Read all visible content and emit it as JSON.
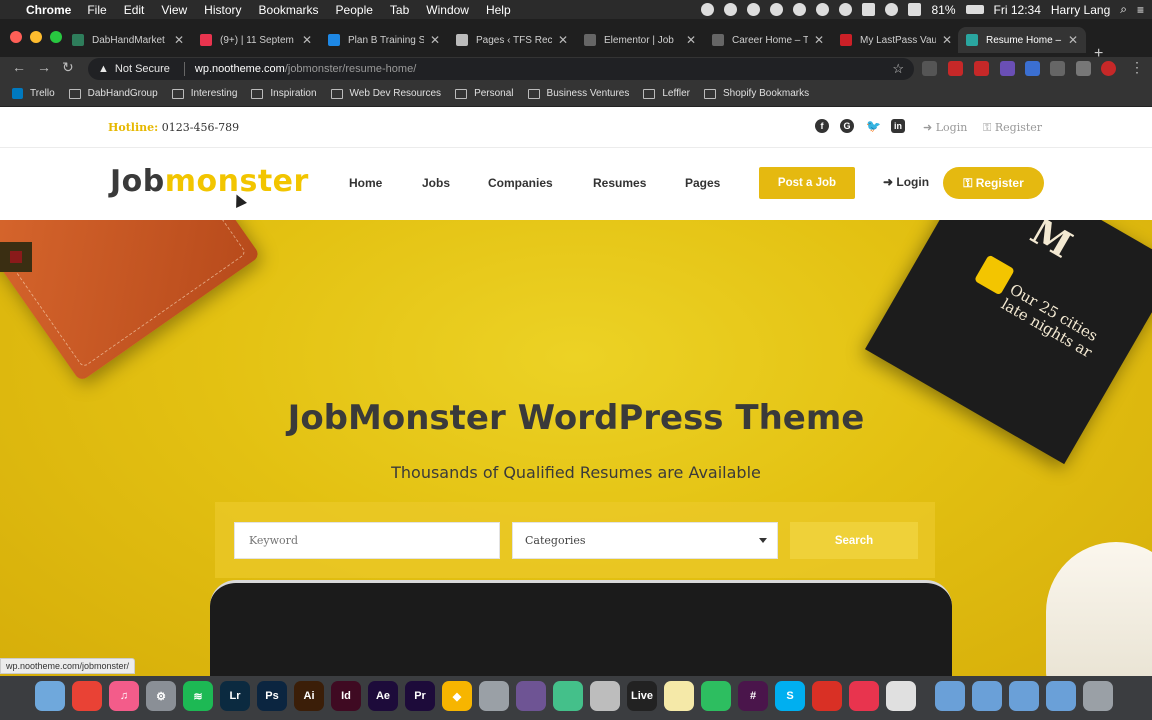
{
  "menubar": {
    "app": "Chrome",
    "items": [
      "File",
      "Edit",
      "View",
      "History",
      "Bookmarks",
      "People",
      "Tab",
      "Window",
      "Help"
    ],
    "battery": "81%",
    "clock": "Fri 12:34",
    "user": "Harry Lang"
  },
  "tabs": [
    {
      "title": "DabHandMarket",
      "color": "#2e7d5b"
    },
    {
      "title": "(9+) | 11 Septem",
      "color": "#e8344e"
    },
    {
      "title": "Plan B Training S",
      "color": "#1e88e5"
    },
    {
      "title": "Pages ‹ TFS Rec",
      "color": "#bbbbbb"
    },
    {
      "title": "Elementor | Job",
      "color": "#666666"
    },
    {
      "title": "Career Home – T",
      "color": "#666666"
    },
    {
      "title": "My LastPass Vau",
      "color": "#cc2027"
    },
    {
      "title": "Resume Home –",
      "color": "#2aa6a0"
    }
  ],
  "address": {
    "security": "Not Secure",
    "host": "wp.nootheme.com",
    "path": "/jobmonster/resume-home/"
  },
  "bookmarks": [
    "Trello",
    "DabHandGroup",
    "Interesting",
    "Inspiration",
    "Web Dev Resources",
    "Personal",
    "Business Ventures",
    "Leffler",
    "Shopify Bookmarks"
  ],
  "topbar": {
    "hotline_label": "Hotline:",
    "hotline_number": "0123-456-789",
    "login": "Login",
    "register": "Register"
  },
  "header": {
    "logo_a": "Job",
    "logo_b": "monster",
    "nav": [
      "Home",
      "Jobs",
      "Companies",
      "Resumes",
      "Pages"
    ],
    "post_job": "Post a Job",
    "login": "Login",
    "register": "Register"
  },
  "hero": {
    "title": "JobMonster WordPress Theme",
    "subtitle": "Thousands of Qualified Resumes are Available",
    "keyword_placeholder": "Keyword",
    "category_value": "Categories",
    "search_label": "Search",
    "magazine_title": "M",
    "magazine_text": "Our 25 cities late nights ar"
  },
  "status_url": "wp.nootheme.com/jobmonster/",
  "dock": [
    {
      "label": "",
      "color": "#6fa8dc",
      "name": "finder-icon"
    },
    {
      "label": "",
      "color": "#e94235",
      "name": "chrome-icon"
    },
    {
      "label": "♫",
      "color": "#f35c8a",
      "name": "itunes-icon"
    },
    {
      "label": "⚙",
      "color": "#8a8f96",
      "name": "system-preferences-icon"
    },
    {
      "label": "≋",
      "color": "#1db954",
      "name": "spotify-icon"
    },
    {
      "label": "Lr",
      "color": "#0b2a40",
      "name": "lightroom-icon"
    },
    {
      "label": "Ps",
      "color": "#0b2540",
      "name": "photoshop-icon"
    },
    {
      "label": "Ai",
      "color": "#3b1e08",
      "name": "illustrator-icon"
    },
    {
      "label": "Id",
      "color": "#3f0a22",
      "name": "indesign-icon"
    },
    {
      "label": "Ae",
      "color": "#1d0b3a",
      "name": "after-effects-icon"
    },
    {
      "label": "Pr",
      "color": "#1d0b3a",
      "name": "premiere-icon"
    },
    {
      "label": "◆",
      "color": "#f7b500",
      "name": "sketch-icon"
    },
    {
      "label": "",
      "color": "#9aa0a6",
      "name": "sequel-pro-icon"
    },
    {
      "label": "",
      "color": "#6e5494",
      "name": "github-icon"
    },
    {
      "label": "",
      "color": "#44c08a",
      "name": "atom-icon"
    },
    {
      "label": "",
      "color": "#bdbdbd",
      "name": "preview-icon"
    },
    {
      "label": "Live",
      "color": "#222222",
      "name": "ableton-live-icon"
    },
    {
      "label": "",
      "color": "#f5e9a8",
      "name": "notes-icon"
    },
    {
      "label": "",
      "color": "#2dbe60",
      "name": "evernote-icon"
    },
    {
      "label": "#",
      "color": "#4a154b",
      "name": "slack-icon"
    },
    {
      "label": "S",
      "color": "#00aff0",
      "name": "skype-icon"
    },
    {
      "label": "",
      "color": "#d93025",
      "name": "filezilla-icon"
    },
    {
      "label": "",
      "color": "#e8344e",
      "name": "lasso-icon"
    },
    {
      "label": "",
      "color": "#e0e0e0",
      "name": "textedit-icon"
    },
    {
      "label": "",
      "color": "#6aa0d8",
      "name": "applications-folder-icon"
    },
    {
      "label": "",
      "color": "#6aa0d8",
      "name": "documents-folder-icon"
    },
    {
      "label": "",
      "color": "#6aa0d8",
      "name": "downloads-folder-icon"
    },
    {
      "label": "",
      "color": "#6aa0d8",
      "name": "stack-folder-icon"
    },
    {
      "label": "",
      "color": "#9aa0a6",
      "name": "trash-icon"
    }
  ],
  "colors": {
    "brand_yellow": "#e5b910",
    "logo_yellow": "#f2c500"
  }
}
